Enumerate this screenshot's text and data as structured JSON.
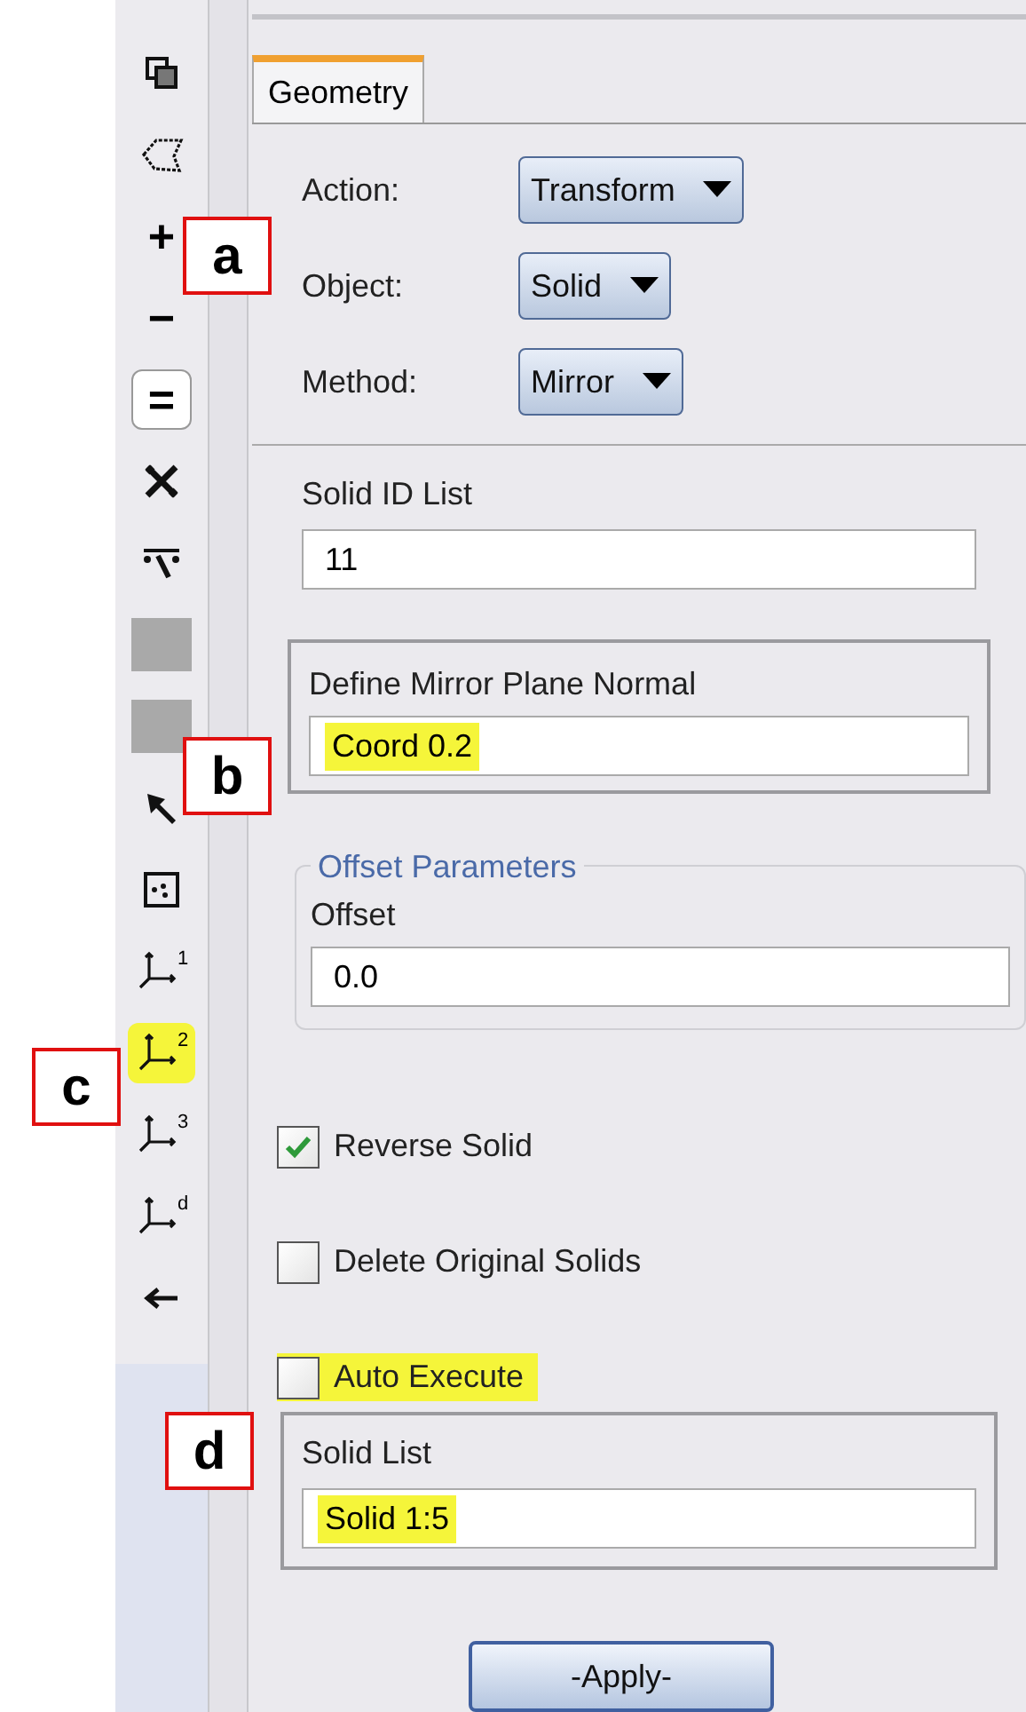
{
  "toolbar": [
    {
      "kind": "layers",
      "pressed": false,
      "highlighted": false
    },
    {
      "kind": "outline",
      "pressed": false,
      "highlighted": false
    },
    {
      "kind": "glyph",
      "text": "+",
      "pressed": false,
      "highlighted": false
    },
    {
      "kind": "glyph",
      "text": "−",
      "pressed": false,
      "highlighted": false
    },
    {
      "kind": "glyph",
      "text": "=",
      "pressed": true,
      "highlighted": false
    },
    {
      "kind": "cross",
      "pressed": false,
      "highlighted": false
    },
    {
      "kind": "filter",
      "pressed": false,
      "highlighted": false
    },
    {
      "kind": "swatch",
      "pressed": false,
      "highlighted": false
    },
    {
      "kind": "swatch",
      "pressed": false,
      "highlighted": false
    },
    {
      "kind": "pointer",
      "pressed": false,
      "highlighted": false
    },
    {
      "kind": "dots",
      "pressed": false,
      "highlighted": false
    },
    {
      "kind": "axis",
      "text": "1",
      "pressed": false,
      "highlighted": false
    },
    {
      "kind": "axis",
      "text": "2",
      "pressed": false,
      "highlighted": true
    },
    {
      "kind": "axis",
      "text": "3",
      "pressed": false,
      "highlighted": false
    },
    {
      "kind": "axis",
      "text": "d",
      "pressed": false,
      "highlighted": false
    },
    {
      "kind": "back",
      "pressed": false,
      "highlighted": false
    }
  ],
  "tabs": [
    {
      "label": "Geometry",
      "selected": true
    }
  ],
  "selectors": [
    {
      "label": "Action:",
      "value": "Transform"
    },
    {
      "label": "Object:",
      "value": "Solid"
    },
    {
      "label": "Method:",
      "value": "Mirror"
    }
  ],
  "solid_id_list": {
    "label": "Solid ID List",
    "value": "11"
  },
  "mirror_plane": {
    "label": "Define Mirror Plane Normal",
    "value": "Coord 0.2",
    "highlighted": true
  },
  "offset_parameters": {
    "title": "Offset Parameters",
    "label": "Offset",
    "value": "0.0"
  },
  "options": [
    {
      "label": "Reverse Solid",
      "checked": true,
      "highlighted": false
    },
    {
      "label": "Delete Original Solids",
      "checked": false,
      "highlighted": false
    },
    {
      "label": "Auto Execute",
      "checked": false,
      "highlighted": true
    }
  ],
  "solid_list": {
    "label": "Solid List",
    "value": "Solid 1:5",
    "highlighted": true
  },
  "apply_button": "-Apply-",
  "callouts": [
    "a",
    "b",
    "c",
    "d"
  ]
}
